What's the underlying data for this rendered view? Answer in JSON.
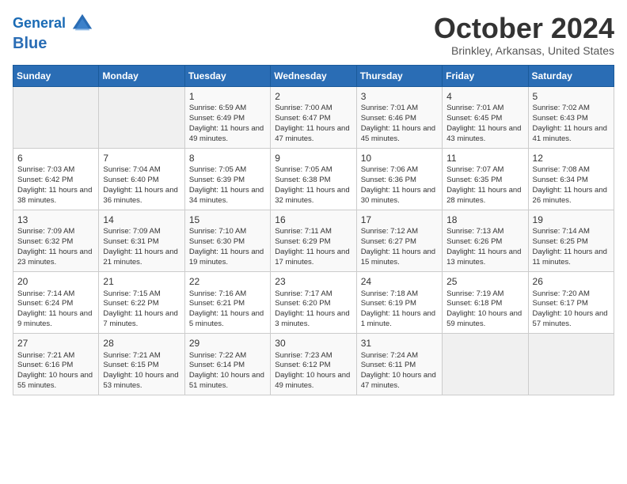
{
  "header": {
    "logo_line1": "General",
    "logo_line2": "Blue",
    "month": "October 2024",
    "location": "Brinkley, Arkansas, United States"
  },
  "days_of_week": [
    "Sunday",
    "Monday",
    "Tuesday",
    "Wednesday",
    "Thursday",
    "Friday",
    "Saturday"
  ],
  "weeks": [
    [
      {
        "day": "",
        "info": ""
      },
      {
        "day": "",
        "info": ""
      },
      {
        "day": "1",
        "info": "Sunrise: 6:59 AM\nSunset: 6:49 PM\nDaylight: 11 hours and 49 minutes."
      },
      {
        "day": "2",
        "info": "Sunrise: 7:00 AM\nSunset: 6:47 PM\nDaylight: 11 hours and 47 minutes."
      },
      {
        "day": "3",
        "info": "Sunrise: 7:01 AM\nSunset: 6:46 PM\nDaylight: 11 hours and 45 minutes."
      },
      {
        "day": "4",
        "info": "Sunrise: 7:01 AM\nSunset: 6:45 PM\nDaylight: 11 hours and 43 minutes."
      },
      {
        "day": "5",
        "info": "Sunrise: 7:02 AM\nSunset: 6:43 PM\nDaylight: 11 hours and 41 minutes."
      }
    ],
    [
      {
        "day": "6",
        "info": "Sunrise: 7:03 AM\nSunset: 6:42 PM\nDaylight: 11 hours and 38 minutes."
      },
      {
        "day": "7",
        "info": "Sunrise: 7:04 AM\nSunset: 6:40 PM\nDaylight: 11 hours and 36 minutes."
      },
      {
        "day": "8",
        "info": "Sunrise: 7:05 AM\nSunset: 6:39 PM\nDaylight: 11 hours and 34 minutes."
      },
      {
        "day": "9",
        "info": "Sunrise: 7:05 AM\nSunset: 6:38 PM\nDaylight: 11 hours and 32 minutes."
      },
      {
        "day": "10",
        "info": "Sunrise: 7:06 AM\nSunset: 6:36 PM\nDaylight: 11 hours and 30 minutes."
      },
      {
        "day": "11",
        "info": "Sunrise: 7:07 AM\nSunset: 6:35 PM\nDaylight: 11 hours and 28 minutes."
      },
      {
        "day": "12",
        "info": "Sunrise: 7:08 AM\nSunset: 6:34 PM\nDaylight: 11 hours and 26 minutes."
      }
    ],
    [
      {
        "day": "13",
        "info": "Sunrise: 7:09 AM\nSunset: 6:32 PM\nDaylight: 11 hours and 23 minutes."
      },
      {
        "day": "14",
        "info": "Sunrise: 7:09 AM\nSunset: 6:31 PM\nDaylight: 11 hours and 21 minutes."
      },
      {
        "day": "15",
        "info": "Sunrise: 7:10 AM\nSunset: 6:30 PM\nDaylight: 11 hours and 19 minutes."
      },
      {
        "day": "16",
        "info": "Sunrise: 7:11 AM\nSunset: 6:29 PM\nDaylight: 11 hours and 17 minutes."
      },
      {
        "day": "17",
        "info": "Sunrise: 7:12 AM\nSunset: 6:27 PM\nDaylight: 11 hours and 15 minutes."
      },
      {
        "day": "18",
        "info": "Sunrise: 7:13 AM\nSunset: 6:26 PM\nDaylight: 11 hours and 13 minutes."
      },
      {
        "day": "19",
        "info": "Sunrise: 7:14 AM\nSunset: 6:25 PM\nDaylight: 11 hours and 11 minutes."
      }
    ],
    [
      {
        "day": "20",
        "info": "Sunrise: 7:14 AM\nSunset: 6:24 PM\nDaylight: 11 hours and 9 minutes."
      },
      {
        "day": "21",
        "info": "Sunrise: 7:15 AM\nSunset: 6:22 PM\nDaylight: 11 hours and 7 minutes."
      },
      {
        "day": "22",
        "info": "Sunrise: 7:16 AM\nSunset: 6:21 PM\nDaylight: 11 hours and 5 minutes."
      },
      {
        "day": "23",
        "info": "Sunrise: 7:17 AM\nSunset: 6:20 PM\nDaylight: 11 hours and 3 minutes."
      },
      {
        "day": "24",
        "info": "Sunrise: 7:18 AM\nSunset: 6:19 PM\nDaylight: 11 hours and 1 minute."
      },
      {
        "day": "25",
        "info": "Sunrise: 7:19 AM\nSunset: 6:18 PM\nDaylight: 10 hours and 59 minutes."
      },
      {
        "day": "26",
        "info": "Sunrise: 7:20 AM\nSunset: 6:17 PM\nDaylight: 10 hours and 57 minutes."
      }
    ],
    [
      {
        "day": "27",
        "info": "Sunrise: 7:21 AM\nSunset: 6:16 PM\nDaylight: 10 hours and 55 minutes."
      },
      {
        "day": "28",
        "info": "Sunrise: 7:21 AM\nSunset: 6:15 PM\nDaylight: 10 hours and 53 minutes."
      },
      {
        "day": "29",
        "info": "Sunrise: 7:22 AM\nSunset: 6:14 PM\nDaylight: 10 hours and 51 minutes."
      },
      {
        "day": "30",
        "info": "Sunrise: 7:23 AM\nSunset: 6:12 PM\nDaylight: 10 hours and 49 minutes."
      },
      {
        "day": "31",
        "info": "Sunrise: 7:24 AM\nSunset: 6:11 PM\nDaylight: 10 hours and 47 minutes."
      },
      {
        "day": "",
        "info": ""
      },
      {
        "day": "",
        "info": ""
      }
    ]
  ]
}
